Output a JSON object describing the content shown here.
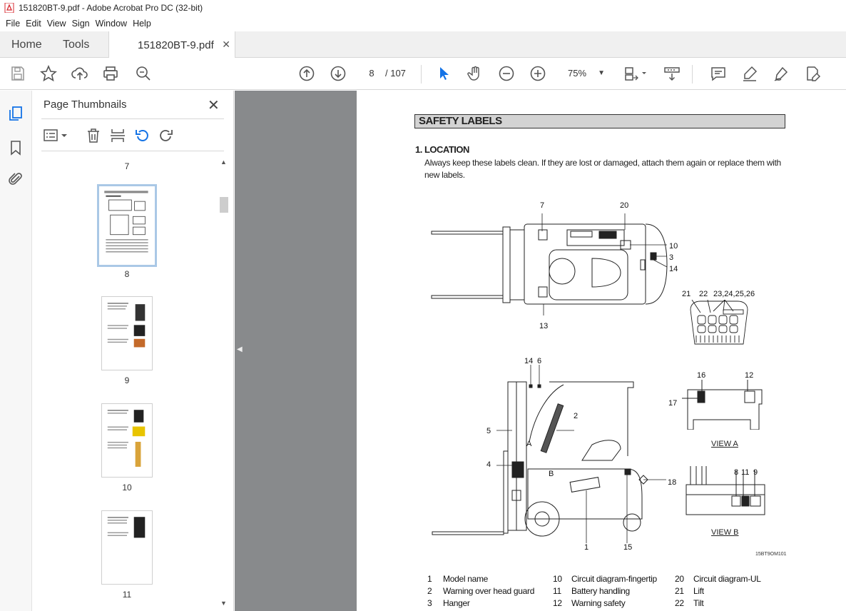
{
  "window": {
    "title": "151820BT-9.pdf - Adobe Acrobat Pro DC (32-bit)"
  },
  "menu": [
    "File",
    "Edit",
    "View",
    "Sign",
    "Window",
    "Help"
  ],
  "tabs": {
    "home": "Home",
    "tools": "Tools",
    "document": "151820BT-9.pdf"
  },
  "toolbar": {
    "page_current": "8",
    "page_total": "/ 107",
    "zoom": "75%"
  },
  "thumbnails": {
    "title": "Page Thumbnails",
    "pages": [
      {
        "label": "7"
      },
      {
        "label": "8",
        "selected": true
      },
      {
        "label": "9"
      },
      {
        "label": "10"
      },
      {
        "label": "11"
      }
    ]
  },
  "document": {
    "section_title": "SAFETY LABELS",
    "location_title": "1. LOCATION",
    "location_text": "Always keep these labels clean.  If they are lost or damaged, attach them again or replace them with new labels.",
    "callouts": {
      "c7": "7",
      "c20": "20",
      "c10": "10",
      "c3": "3",
      "c14": "14",
      "c13": "13",
      "c21": "21",
      "c22": "22",
      "c23": "23,24,25,26",
      "s14": "14",
      "s6": "6",
      "s2": "2",
      "s5": "5",
      "s4": "4",
      "sA": "A",
      "sB": "B",
      "s18": "18",
      "s1": "1",
      "s15": "15",
      "v16": "16",
      "v12": "12",
      "v17": "17",
      "v8": "8",
      "v11": "11",
      "v9": "9"
    },
    "view_a": "VIEW A",
    "view_b": "VIEW B",
    "drawing_code": "15BT9OM101",
    "legend": [
      {
        "num": "1",
        "text": "Model name"
      },
      {
        "num": "2",
        "text": "Warning over head guard"
      },
      {
        "num": "3",
        "text": "Hanger"
      },
      {
        "num": "10",
        "text": "Circuit diagram-fingertip"
      },
      {
        "num": "11",
        "text": "Battery handling"
      },
      {
        "num": "12",
        "text": "Warning safety"
      },
      {
        "num": "20",
        "text": "Circuit diagram-UL"
      },
      {
        "num": "21",
        "text": "Lift"
      },
      {
        "num": "22",
        "text": "Tilt"
      }
    ]
  },
  "colors": {
    "accent": "#1473e6",
    "pdf_red": "#d7282f",
    "doc_bg": "#888a8c"
  }
}
